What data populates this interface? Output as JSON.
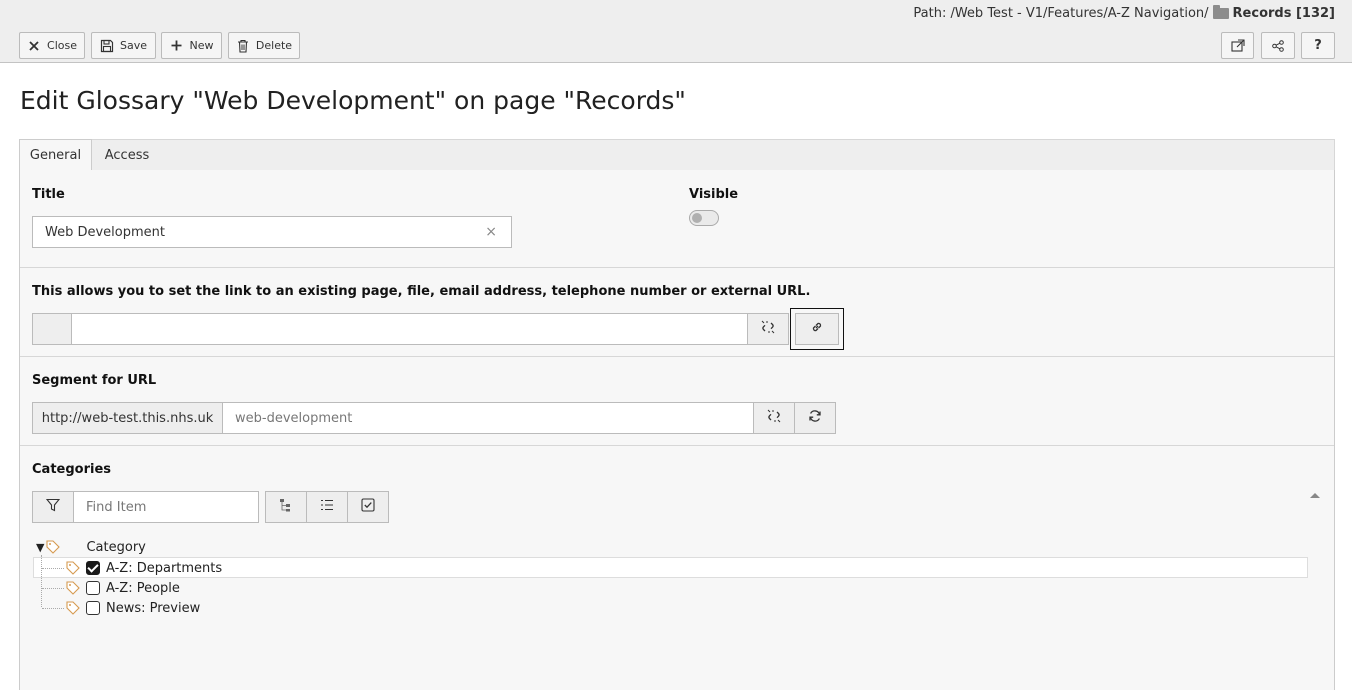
{
  "path": {
    "prefix": "Path: /Web Test - V1/Features/A-Z Navigation/",
    "current": "Records [132]"
  },
  "toolbar": {
    "close_label": "Close",
    "save_label": "Save",
    "new_label": "New",
    "delete_label": "Delete",
    "help_label": "?"
  },
  "page_title": "Edit Glossary \"Web Development\" on page \"Records\"",
  "tabs": [
    {
      "label": "General"
    },
    {
      "label": "Access"
    }
  ],
  "form": {
    "title_label": "Title",
    "title_value": "Web Development",
    "visible_label": "Visible",
    "link_label": "This allows you to set the link to an existing page, file, email address, telephone number or external URL.",
    "link_value": "",
    "segment_label": "Segment for URL",
    "segment_prefix": "http://web-test.this.nhs.uk",
    "segment_placeholder": "web-development",
    "categories_label": "Categories",
    "filter_placeholder": "Find Item"
  },
  "tree": {
    "root": "Category",
    "items": [
      {
        "label": "A-Z: Departments",
        "checked": true
      },
      {
        "label": "A-Z: People",
        "checked": false
      },
      {
        "label": "News: Preview",
        "checked": false
      }
    ]
  },
  "colors": {
    "header_bg": "#eeeeee",
    "panel_bg": "#f7f7f7",
    "tag_icon": "#f0a030"
  },
  "icons": [
    "close-icon",
    "save-icon",
    "plus-icon",
    "trash-icon",
    "open-window-icon",
    "share-icon",
    "help-icon",
    "link-icon",
    "unlink-icon",
    "refresh-icon",
    "filter-icon",
    "tree-icon",
    "list-icon",
    "check-all-icon",
    "tag-icon",
    "folder-icon"
  ]
}
